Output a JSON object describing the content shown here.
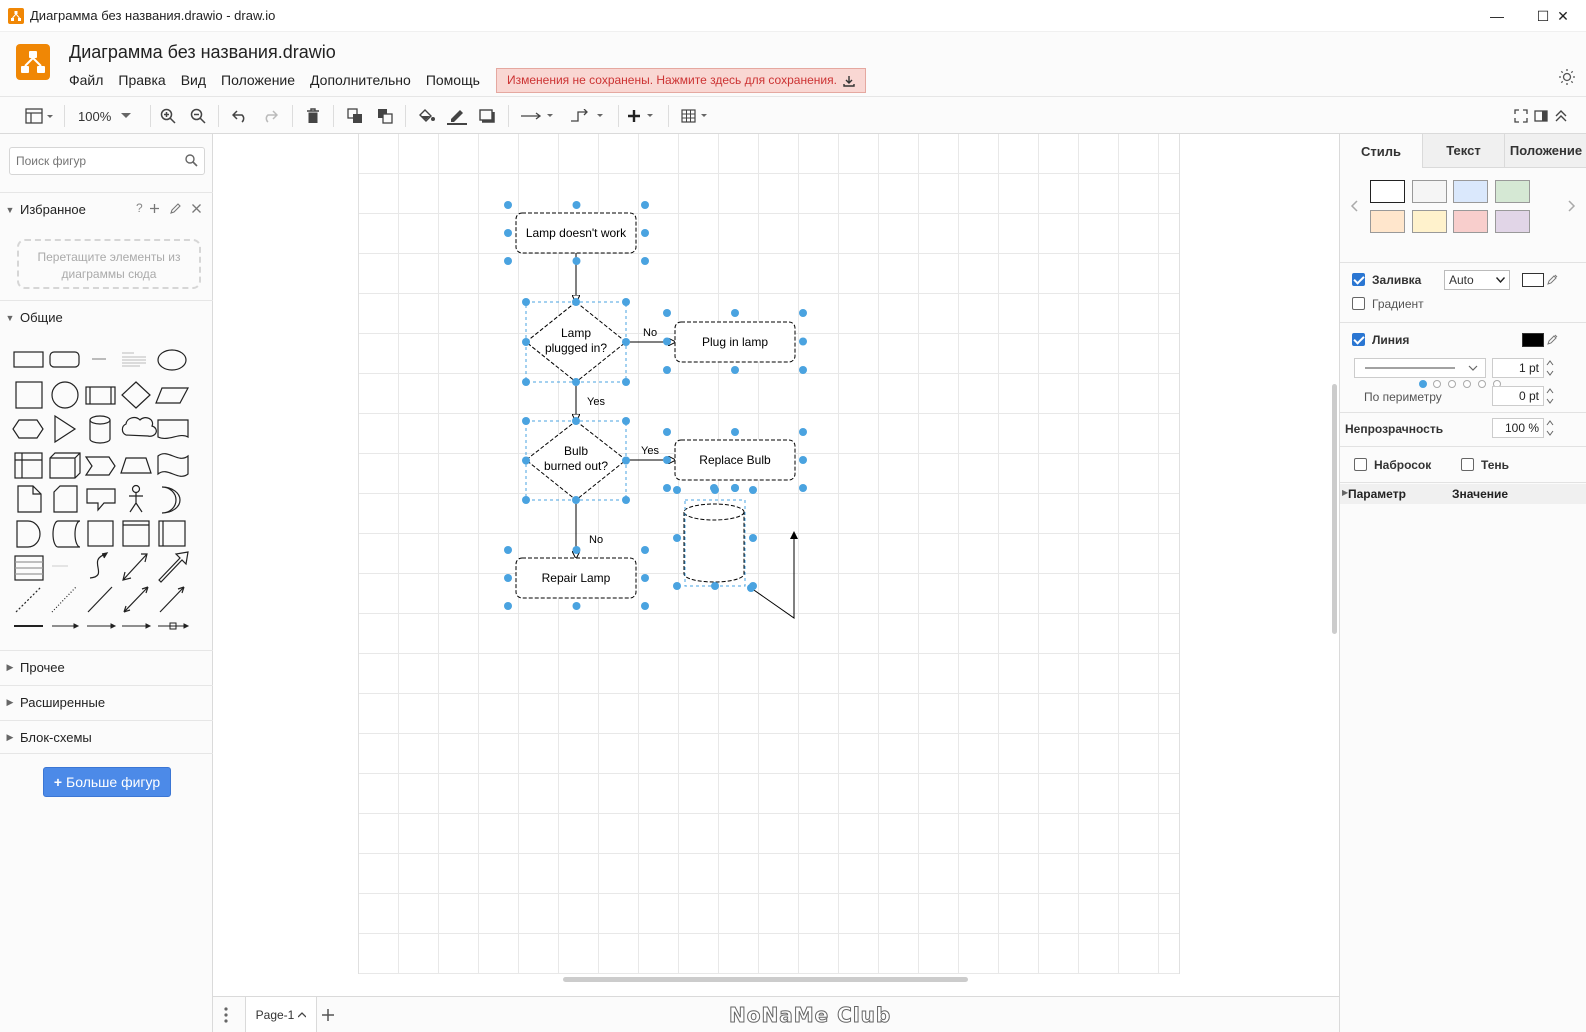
{
  "window": {
    "title": "Диаграмма без названия.drawio - draw.io",
    "minimize": "—",
    "maximize": "☐",
    "close": "✕"
  },
  "header": {
    "doc_title": "Диаграмма без названия.drawio",
    "menu": [
      "Файл",
      "Правка",
      "Вид",
      "Положение",
      "Дополнительно",
      "Помощь"
    ],
    "unsaved_notice": "Изменения не сохранены. Нажмите здесь для сохранения."
  },
  "toolbar": {
    "zoom": "100%"
  },
  "sidebar": {
    "search_placeholder": "Поиск фигур",
    "favorites": {
      "title": "Избранное",
      "help": "?",
      "drop_hint": "Перетащите элементы из диаграммы сюда"
    },
    "general_title": "Общие",
    "collapsed_sections": [
      "Прочее",
      "Расширенные",
      "Блок-схемы"
    ],
    "more_shapes": "Больше фигур",
    "more_shapes_plus": "+"
  },
  "diagram": {
    "nodes": {
      "start": "Lamp doesn't work",
      "plugged": [
        "Lamp",
        "plugged in?"
      ],
      "plug": "Plug in lamp",
      "burned": [
        "Bulb",
        "burned out?"
      ],
      "replace": "Replace Bulb",
      "repair": "Repair Lamp"
    },
    "edge_labels": {
      "plugged_no": "No",
      "plugged_yes": "Yes",
      "burned_yes": "Yes",
      "burned_no": "No"
    },
    "selection_color": "#4aa3e0"
  },
  "bottom": {
    "page_tab": "Page-1",
    "watermark": "NoNaMe Club"
  },
  "right_panel": {
    "tabs": [
      "Стиль",
      "Текст",
      "Положение"
    ],
    "swatches": [
      "#ffffff",
      "#f5f5f5",
      "#dae8fc",
      "#d5e8d4",
      "#ffe6cc",
      "#fff2cc",
      "#f8cecc",
      "#e1d5e7"
    ],
    "fill_label": "Заливка",
    "fill_mode": "Auto",
    "gradient_label": "Градиент",
    "line_label": "Линия",
    "line_width": "1 pt",
    "perimeter_label": "По периметру",
    "perimeter_value": "0 pt",
    "opacity_label": "Непрозрачность",
    "opacity_value": "100 %",
    "sketch_label": "Набросок",
    "shadow_label": "Тень",
    "param_header": "Параметр",
    "value_header": "Значение"
  }
}
